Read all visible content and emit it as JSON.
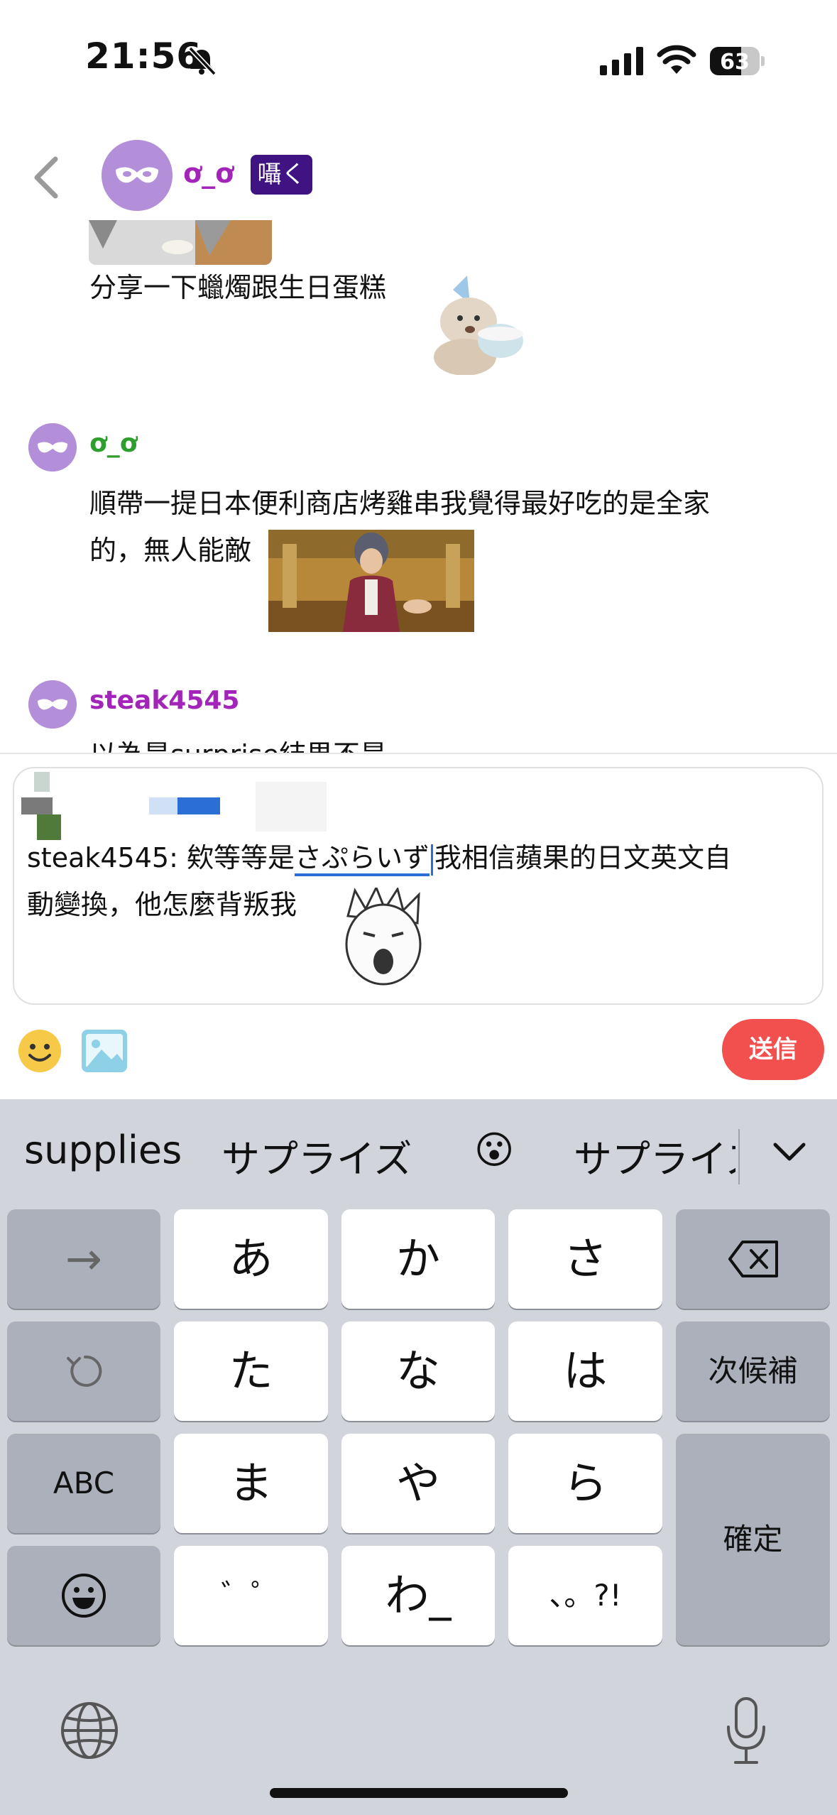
{
  "status_bar": {
    "time": "21:56",
    "battery": "63",
    "battery_level": 0.63
  },
  "header": {
    "back_icon": "chevron-left-icon",
    "name": "ơ_ơ",
    "badge": "囁く"
  },
  "messages": [
    {
      "text": "分享一下蠟燭跟生日蛋糕"
    },
    {
      "username": "ơ_ơ",
      "username_color": "#2e9e2e",
      "text_line1": "順帶一提日本便利商店烤雞串我覺得最好吃的是全家",
      "text_line2": "的，無人能敵"
    },
    {
      "username": "steak4545",
      "username_color": "#a324b8",
      "text_partial": "以為是surprise結果不是"
    }
  ],
  "composer": {
    "prefix": "steak4545: 欸等等是",
    "marked": "さぷらいず",
    "rest_line1": "我相信蘋果的日文英文自",
    "line2": "動變換，他怎麼背叛我",
    "send_label": "送信",
    "emoji_icon": "smiley-icon",
    "image_icon": "image-icon"
  },
  "keyboard": {
    "candidates": [
      "supplies",
      "サプライズ",
      "😮",
      "サプライズ"
    ],
    "keys": {
      "arrow": "→",
      "a": "あ",
      "ka": "か",
      "sa": "さ",
      "ta": "た",
      "na": "な",
      "ha": "は",
      "next_candidate": "次候補",
      "abc": "ABC",
      "ma": "ま",
      "ya": "や",
      "ra": "ら",
      "confirm": "確定",
      "dakuten": "゛゜",
      "wa": "わ_",
      "punct": "、。?!"
    },
    "accent": "#2b6fd6",
    "send_color": "#f24f4f"
  }
}
